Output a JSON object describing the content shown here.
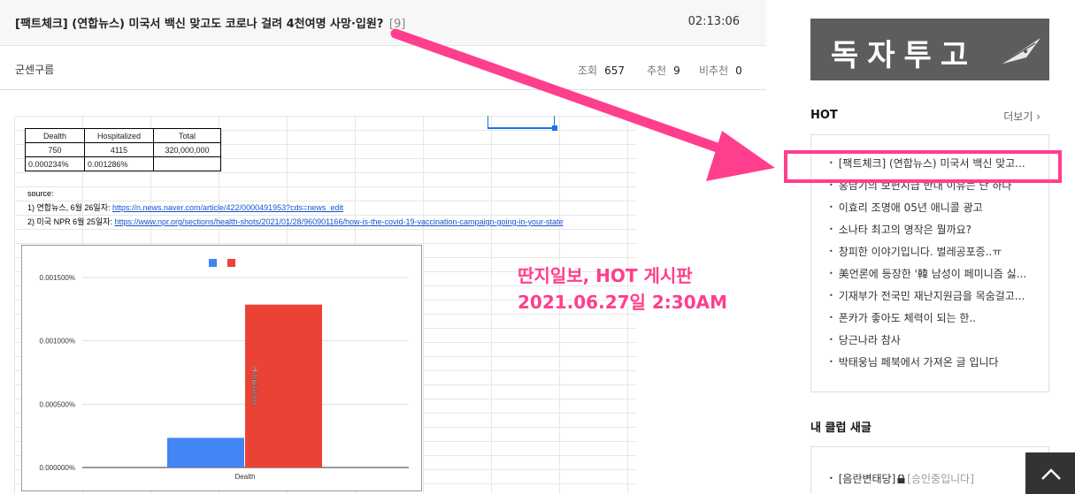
{
  "post": {
    "title": "[팩트체크] (연합뉴스) 미국서 백신 맞고도 코로나 걸려 4천여명 사망·입원?",
    "comment_count": "[9]",
    "time": "02:13:06",
    "author": "군센구름",
    "views_label": "조회",
    "views": "657",
    "likes_label": "추천",
    "likes": "9",
    "dislikes_label": "비추천",
    "dislikes": "0"
  },
  "sheet": {
    "table": {
      "headers": [
        "Dealth",
        "Hospitalized",
        "Total"
      ],
      "row1": [
        "750",
        "4115",
        "320,000,000"
      ],
      "row2": [
        "0.000234%",
        "0.001286%",
        ""
      ]
    },
    "source_label": "source:",
    "source1_prefix": "1) 연합뉴스, 6월 26일자: ",
    "source1_link": "https://n.news.naver.com/article/422/0000491953?cds=news_edit",
    "source2_prefix": "2) 미국 NPR 6월 25일자: ",
    "source2_link": "https://www.npr.org/sections/health-shots/2021/01/28/960901166/how-is-the-covid-19-vaccination-campaign-going-in-your-state"
  },
  "chart_data": {
    "type": "bar",
    "categories": [
      "Dealth"
    ],
    "series": [
      {
        "name": "",
        "values": [
          0.000234
        ],
        "color": "#4285f4"
      },
      {
        "name": "",
        "values": [
          0.001286
        ],
        "color": "#ea4335",
        "label": "Hospitalized"
      }
    ],
    "ylim": [
      0,
      0.0015
    ],
    "yticks": [
      "0.000000%",
      "0.000500%",
      "0.001000%",
      "0.001500%"
    ],
    "ytick_values": [
      0,
      0.0005,
      0.001,
      0.0015
    ],
    "grid": true,
    "legend": "top-center"
  },
  "annotation": {
    "line1": "딴지일보, HOT 게시판",
    "line2": "2021.06.27일 2:30AM",
    "color": "#ff3e8d"
  },
  "sidebar": {
    "banner_text": "독자투고",
    "hot_title": "HOT",
    "more_label": "더보기 ›",
    "hot_items": [
      "[팩트체크] (연합뉴스) 미국서 백신 맞고...",
      "홍남기의 보편지급 반대 이유는 단 하나",
      "이효리 조명애 05년 애니콜 광고",
      "소나타 최고의 명작은 뭘까요?",
      "창피한 이야기입니다. 벌레공포증..ㅠ",
      "美언론에 등장한 '韓 남성이 페미니즘 싫...",
      "기재부가 전국민 재난지원금을 목숨걸고...",
      "폰카가 좋아도 체력이 되는 한..",
      "당근나라 참사",
      "박태웅님 페북에서 가져온 글 입니다"
    ],
    "club_title": "내 클럽 새글",
    "club_item_name": "[음란변태당]",
    "club_item_status": "[승인중입니다]"
  }
}
